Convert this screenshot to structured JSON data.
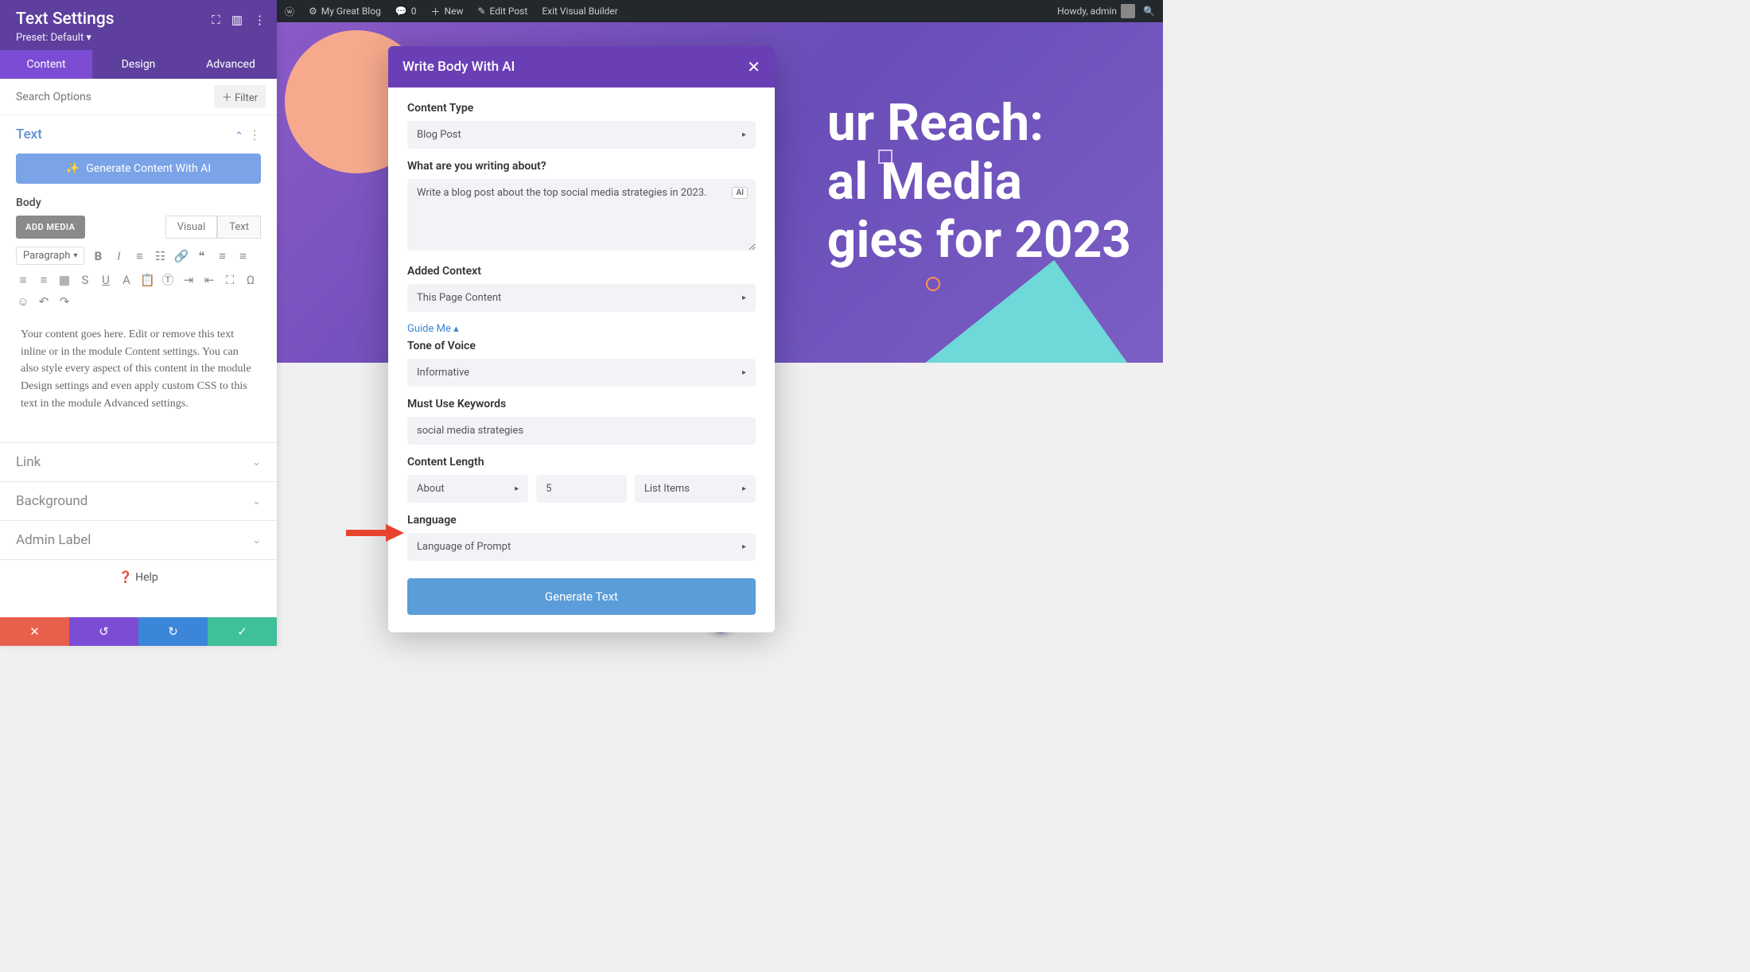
{
  "sidebar": {
    "title": "Text Settings",
    "preset": "Preset: Default ▾",
    "tabs": {
      "content": "Content",
      "design": "Design",
      "advanced": "Advanced"
    },
    "search_placeholder": "Search Options",
    "filter": "Filter",
    "sections": {
      "text": "Text",
      "link": "Link",
      "background": "Background",
      "admin_label": "Admin Label"
    },
    "generate_btn": "Generate Content With AI",
    "body_label": "Body",
    "add_media": "ADD MEDIA",
    "editor_tabs": {
      "visual": "Visual",
      "text": "Text"
    },
    "paragraph": "Paragraph",
    "body_text": "Your content goes here. Edit or remove this text inline or in the module Content settings. You can also style every aspect of this content in the module Design settings and even apply custom CSS to this text in the module Advanced settings.",
    "help": "Help"
  },
  "wpbar": {
    "site": "My Great Blog",
    "comments": "0",
    "new": "New",
    "edit": "Edit Post",
    "exit": "Exit Visual Builder",
    "howdy": "Howdy, admin"
  },
  "hero": {
    "line1": "ur Reach:",
    "line2": "al Media",
    "line3": "gies for 2023"
  },
  "modal": {
    "title": "Write Body With AI",
    "content_type_label": "Content Type",
    "content_type": "Blog Post",
    "prompt_label": "What are you writing about?",
    "prompt": "Write a blog post about the top social media strategies in 2023.",
    "context_label": "Added Context",
    "context": "This Page Content",
    "guide": "Guide Me  ▴",
    "tone_label": "Tone of Voice",
    "tone": "Informative",
    "keywords_label": "Must Use Keywords",
    "keywords": "social media strategies",
    "length_label": "Content Length",
    "length_about": "About",
    "length_count": "5",
    "length_unit": "List Items",
    "language_label": "Language",
    "language": "Language of Prompt",
    "generate": "Generate Text"
  }
}
